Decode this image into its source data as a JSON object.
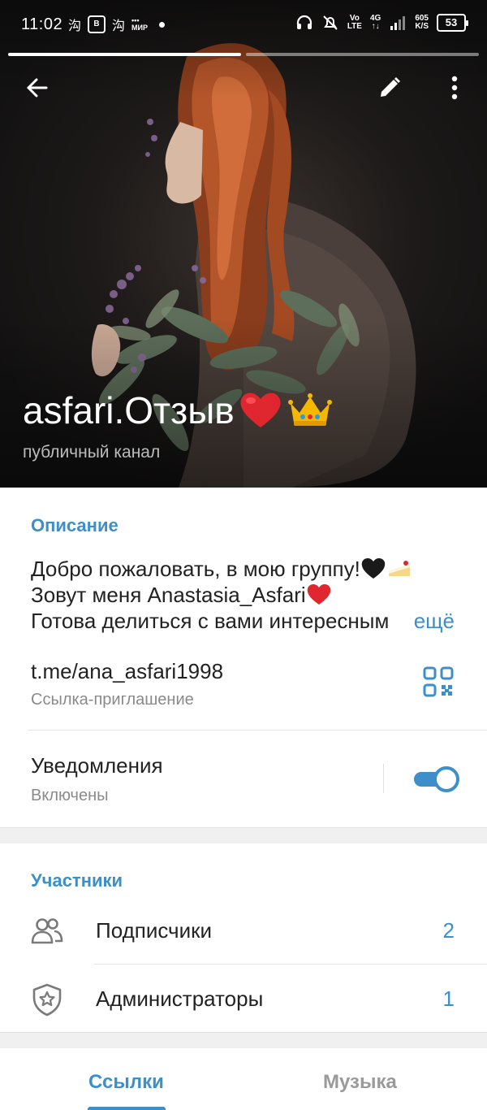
{
  "status_bar": {
    "time": "11:02",
    "network_type": "4G",
    "volte": "Vo LTE",
    "data_speed": "605 K/S",
    "battery": "53"
  },
  "stories": {
    "count": 2,
    "active_index": 0
  },
  "header": {
    "title": "asfari.Отзыв",
    "title_emojis": [
      "red-heart",
      "crown"
    ],
    "subtitle": "публичный канал"
  },
  "description": {
    "section_title": "Описание",
    "line1": "Добро пожаловать, в мою группу!",
    "line1_emojis": [
      "black-heart",
      "cake"
    ],
    "line2": "Зовут меня Anastasia_Asfari",
    "line2_emojis": [
      "red-heart"
    ],
    "line3": "Готова делиться с вами интересным",
    "more_label": "ещё"
  },
  "invite_link": {
    "value": "t.me/ana_asfari1998",
    "label": "Ссылка-приглашение"
  },
  "notifications": {
    "title": "Уведомления",
    "status": "Включены",
    "enabled": true
  },
  "members": {
    "section_title": "Участники",
    "items": [
      {
        "label": "Подписчики",
        "count": "2",
        "icon": "people-icon"
      },
      {
        "label": "Администраторы",
        "count": "1",
        "icon": "shield-star-icon"
      }
    ]
  },
  "tabs": [
    {
      "label": "Ссылки",
      "active": true
    },
    {
      "label": "Музыка",
      "active": false
    }
  ],
  "colors": {
    "accent": "#3d8fc9",
    "hero_bg": "#1a1817",
    "secondary_text": "#8a8a8a"
  }
}
